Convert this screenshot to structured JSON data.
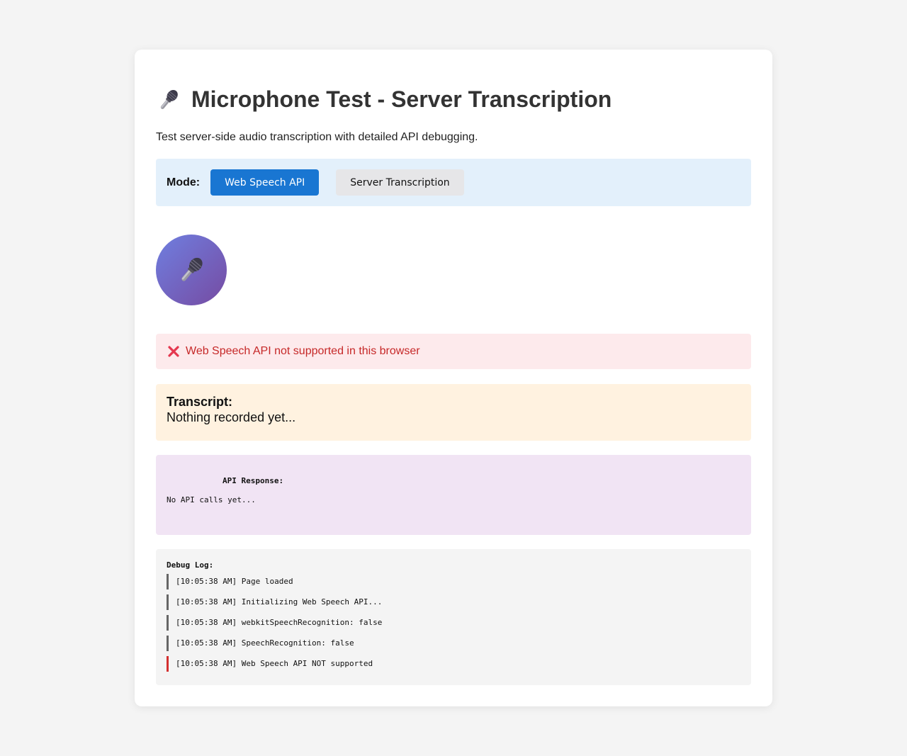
{
  "header": {
    "title": "Microphone Test - Server Transcription",
    "title_icon": "microphone-icon",
    "subtitle": "Test server-side audio transcription with detailed API debugging."
  },
  "mode": {
    "label": "Mode:",
    "options": [
      "Web Speech API",
      "Server Transcription"
    ],
    "selected": "Web Speech API"
  },
  "record_button": {
    "icon": "microphone-icon"
  },
  "status": {
    "icon": "cross-mark-icon",
    "message": "Web Speech API not supported in this browser"
  },
  "transcript": {
    "label": "Transcript:",
    "text": "Nothing recorded yet..."
  },
  "api_response": {
    "label": "API Response:",
    "text": "No API calls yet..."
  },
  "debug_log": {
    "title": "Debug Log:",
    "entries": [
      {
        "text": "[10:05:38 AM] Page loaded",
        "level": "info"
      },
      {
        "text": "[10:05:38 AM] Initializing Web Speech API...",
        "level": "info"
      },
      {
        "text": "[10:05:38 AM] webkitSpeechRecognition: false",
        "level": "info"
      },
      {
        "text": "[10:05:38 AM] SpeechRecognition: false",
        "level": "info"
      },
      {
        "text": "[10:05:38 AM] Web Speech API NOT supported",
        "level": "error"
      }
    ]
  },
  "colors": {
    "primary": "#1976d2",
    "error": "#c62828",
    "mode_bar_bg": "#e3f0fb",
    "error_bg": "#fdeaec",
    "transcript_bg": "#fff2e0",
    "api_bg": "#f1e4f4",
    "debug_bg": "#f4f4f4"
  }
}
